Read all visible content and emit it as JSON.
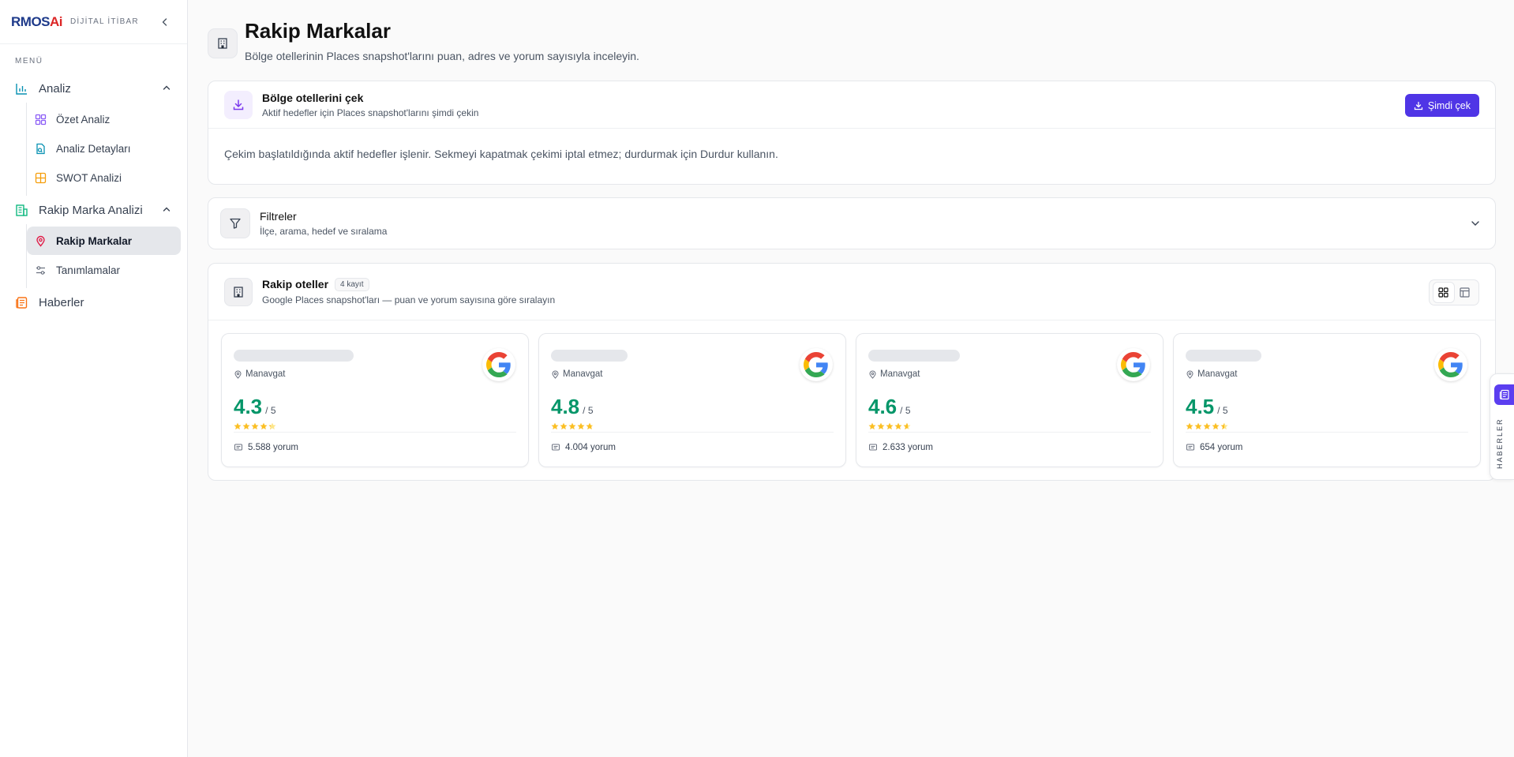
{
  "brand": {
    "logo_main": "RMOS",
    "logo_accent": "Ai",
    "subtitle": "DİJİTAL İTİBAR"
  },
  "sidebar": {
    "menu_label": "MENÜ",
    "groups": [
      {
        "label": "Analiz",
        "items": [
          "Özet Analiz",
          "Analiz Detayları",
          "SWOT Analizi"
        ]
      },
      {
        "label": "Rakip Marka Analizi",
        "items": [
          "Rakip Markalar",
          "Tanımlamalar"
        ]
      },
      {
        "label": "Haberler"
      }
    ]
  },
  "page": {
    "title": "Rakip Markalar",
    "subtitle": "Bölge otellerinin Places snapshot'larını puan, adres ve yorum sayısıyla inceleyin."
  },
  "fetch": {
    "title": "Bölge otellerini çek",
    "subtitle": "Aktif hedefler için Places snapshot'larını şimdi çekin",
    "button": "Şimdi çek",
    "note": "Çekim başlatıldığında aktif hedefler işlenir. Sekmeyi kapatmak çekimi iptal etmez; durdurmak için Durdur kullanın."
  },
  "filters": {
    "title": "Filtreler",
    "subtitle": "İlçe, arama, hedef ve sıralama"
  },
  "competitors": {
    "title": "Rakip oteller",
    "count": "4 kayıt",
    "subtitle": "Google Places snapshot'ları — puan ve yorum sayısına göre sıralayın",
    "hotels": [
      {
        "location": "Manavgat",
        "rating": "4.3",
        "max": "/ 5",
        "stars": 4.3,
        "reviews": "5.588 yorum"
      },
      {
        "location": "Manavgat",
        "rating": "4.8",
        "max": "/ 5",
        "stars": 4.8,
        "reviews": "4.004 yorum"
      },
      {
        "location": "Manavgat",
        "rating": "4.6",
        "max": "/ 5",
        "stars": 4.6,
        "reviews": "2.633 yorum"
      },
      {
        "location": "Manavgat",
        "rating": "4.5",
        "max": "/ 5",
        "stars": 4.5,
        "reviews": "654 yorum"
      }
    ]
  },
  "news_tab": {
    "label": "HABERLER"
  },
  "colors": {
    "accent": "#4f35e6",
    "rating_green": "#059669",
    "star": "#fbbf24"
  }
}
